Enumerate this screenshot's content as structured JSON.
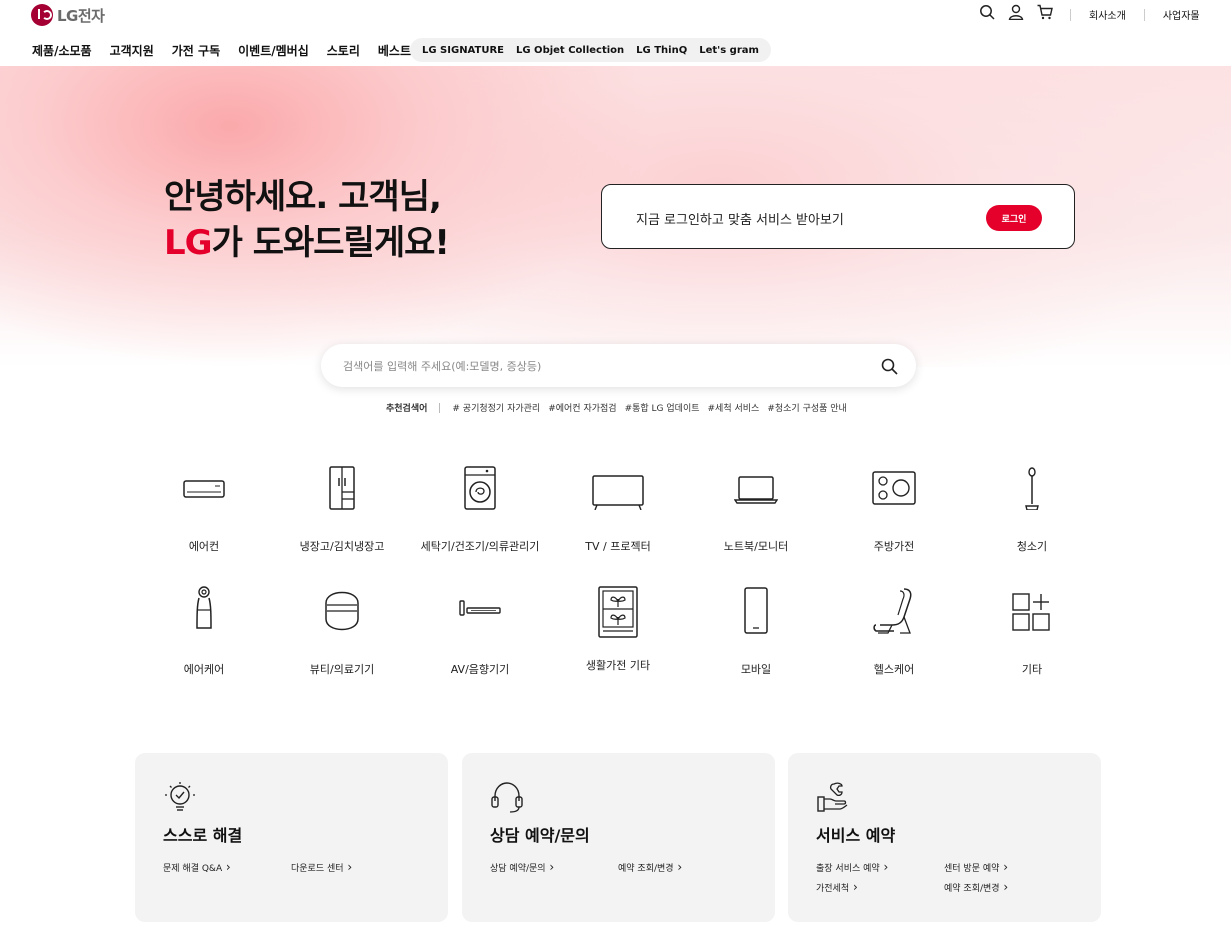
{
  "brand": {
    "logo_text": "LG전자",
    "accent": "#e4002b",
    "logo_color": "#a50034"
  },
  "top_links": [
    "회사소개",
    "사업자몰"
  ],
  "icons": [
    "search-icon",
    "user-icon",
    "cart-icon"
  ],
  "gnb": [
    "제품/소모품",
    "고객지원",
    "가전 구독",
    "이벤트/멤버십",
    "스토리",
    "베스트샵"
  ],
  "brands": [
    "LG SIGNATURE",
    "LG Objet Collection",
    "LG ThinQ",
    "Let's gram"
  ],
  "hero": {
    "line1": "안녕하세요. 고객님,",
    "line2_accent": "LG",
    "line2_rest": "가 도와드릴게요!"
  },
  "login": {
    "message": "지금 로그인하고 맞춤 서비스 받아보기",
    "button": "로그인"
  },
  "search": {
    "placeholder": "검색어를 입력해 주세요(예:모델명, 증상등)"
  },
  "recommended": {
    "label": "추천검색어",
    "terms": [
      "# 공기청정기 자가관리",
      "#에어컨 자가점검",
      "#통합 LG 업데이트",
      "#세척 서비스",
      "#청소기 구성품 안내"
    ]
  },
  "categories": [
    "에어컨",
    "냉장고/김치냉장고",
    "세탁기/건조기/의류관리기",
    "TV / 프로젝터",
    "노트북/모니터",
    "주방가전",
    "청소기",
    "에어케어",
    "뷰티/의료기기",
    "AV/음향기기",
    "생활가전 기타",
    "모바일",
    "헬스케어",
    "기타"
  ],
  "cards": [
    {
      "title": "스스로 해결",
      "links": [
        "문제 해결 Q&A",
        "다운로드 센터"
      ]
    },
    {
      "title": "상담 예약/문의",
      "links": [
        "상담 예약/문의",
        "예약 조회/변경"
      ]
    },
    {
      "title": "서비스 예약",
      "links": [
        "출장 서비스 예약",
        "센터 방문 예약",
        "가전세척",
        "예약 조회/변경"
      ]
    }
  ]
}
